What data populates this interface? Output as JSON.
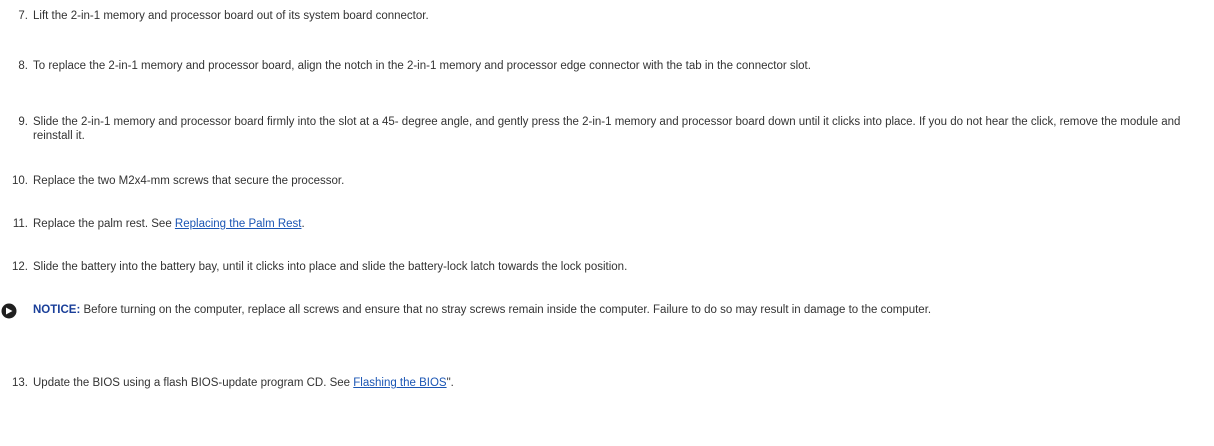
{
  "steps": [
    {
      "num": "7.",
      "text": "Lift the 2-in-1 memory and processor board out of its system board connector."
    },
    {
      "num": "8.",
      "text": "To replace the 2-in-1 memory and processor board, align the notch in the 2-in-1 memory and processor edge connector with the tab in the connector slot."
    },
    {
      "num": "9.",
      "text": "Slide the 2-in-1 memory and processor board firmly into the slot at a 45- degree angle, and gently press the 2-in-1 memory and processor board down until it clicks into place. If you do not hear the click, remove the module and reinstall it."
    },
    {
      "num": "10.",
      "text": "Replace the two M2x4-mm screws that secure the processor."
    },
    {
      "num": "11.",
      "text_before": "Replace the palm rest. See ",
      "link": "Replacing the Palm Rest",
      "text_after": "."
    },
    {
      "num": "12.",
      "text": "Slide the battery into the battery bay, until it clicks into place and slide the battery-lock latch towards the lock position."
    },
    {
      "num": "13.",
      "text_before": "Update the BIOS using a flash BIOS-update program CD. See ",
      "link": "Flashing the BIOS",
      "text_after": "\"."
    }
  ],
  "notice": {
    "icon": "notice-icon",
    "label": "NOTICE:",
    "text": " Before turning on the computer, replace all screws and ensure that no stray screws remain inside the computer. Failure to do so may result in damage to the computer."
  },
  "colors": {
    "text": "#333333",
    "link": "#1a55b4",
    "notice_label": "#1a3f99",
    "icon": "#1f1f1f"
  }
}
